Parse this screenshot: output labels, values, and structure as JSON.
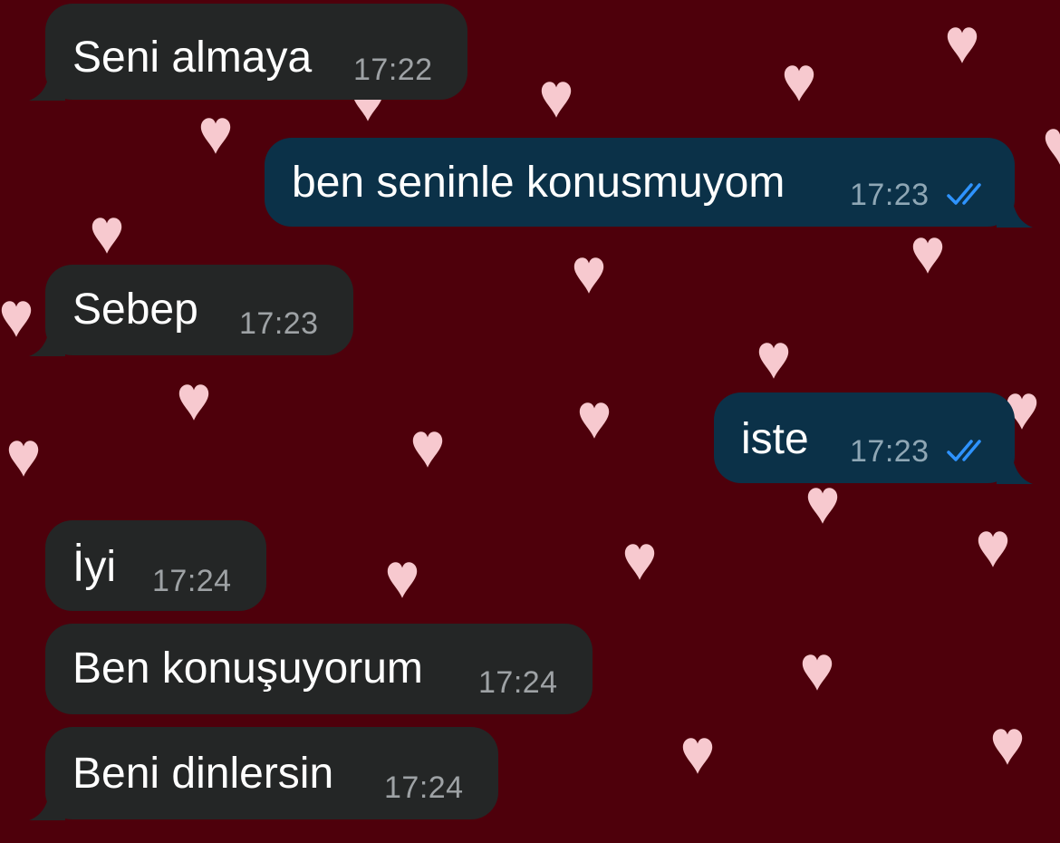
{
  "colors": {
    "background": "#4e000b",
    "heart": "#f7c9cf",
    "incoming_bubble": "#242626",
    "outgoing_bubble": "#0b3148",
    "timestamp": "#9ea2a5",
    "read_receipt": "#2e93ff"
  },
  "background_icon": "heart-icon",
  "messages": [
    {
      "direction": "incoming",
      "text": "Seni almaya",
      "time": "17:22"
    },
    {
      "direction": "outgoing",
      "text": "ben seninle konusmuyom",
      "time": "17:23",
      "status_icon": "double-check-icon"
    },
    {
      "direction": "incoming",
      "text": "Sebep",
      "time": "17:23"
    },
    {
      "direction": "outgoing",
      "text": "iste",
      "time": "17:23",
      "status_icon": "double-check-icon"
    },
    {
      "direction": "incoming",
      "text": "İyi",
      "time": "17:24"
    },
    {
      "direction": "incoming",
      "text": "Ben konuşuyorum",
      "time": "17:24"
    },
    {
      "direction": "incoming",
      "text": "Beni dinlersin",
      "time": "17:24"
    }
  ]
}
